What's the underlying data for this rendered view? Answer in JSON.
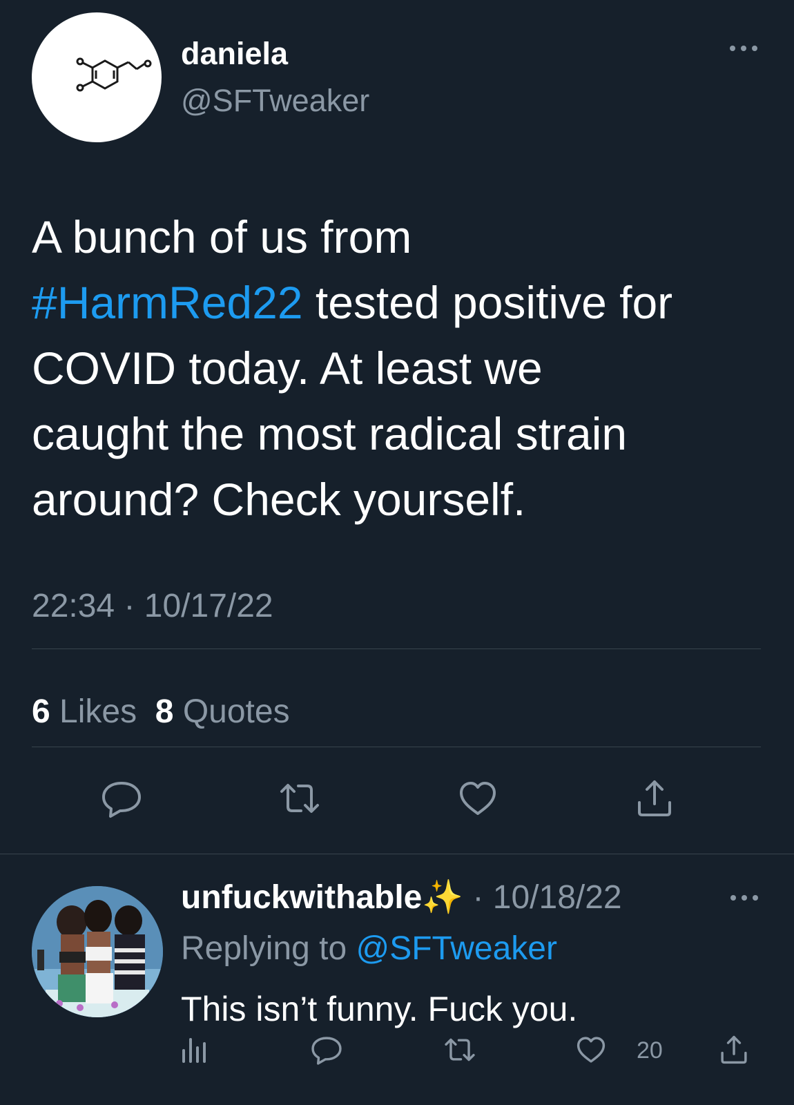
{
  "tweet": {
    "author_name": "daniela",
    "author_handle": "@SFTweaker",
    "text_part1": "A bunch of us from",
    "hashtag": "#HarmRed22",
    "text_part2": " tested positive for",
    "text_part3": "COVID today. At least we",
    "text_part4": "caught the most radical strain",
    "text_part5": "around? Check yourself.",
    "timestamp": "22:34 · 10/17/22",
    "likes_count": "6",
    "likes_label": "Likes",
    "quotes_count": "8",
    "quotes_label": "Quotes",
    "actions": [
      "reply-icon",
      "retweet-icon",
      "like-icon",
      "share-icon"
    ]
  },
  "reply": {
    "author_name": "unfuckwithable",
    "sparkle": "✨",
    "date": " · 10/18/22",
    "replying_prefix": "Replying to ",
    "replying_to": "@SFTweaker",
    "text": "This isn’t funny. Fuck you.",
    "like_count": "20",
    "actions": [
      "analytics-icon",
      "reply-icon",
      "retweet-icon",
      "like-icon",
      "share-icon"
    ]
  },
  "colors": {
    "background": "#16202b",
    "accent": "#1d9bf0",
    "muted_text": "#8b98a5",
    "divider": "#38444d"
  }
}
